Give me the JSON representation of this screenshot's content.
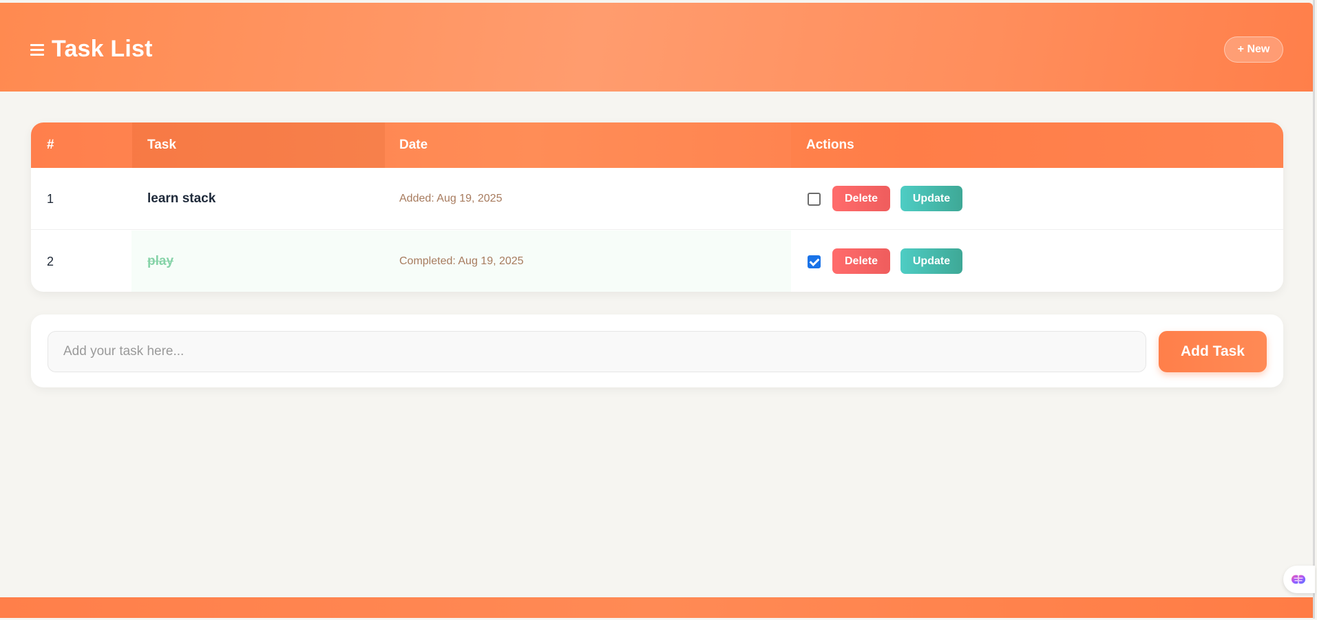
{
  "header": {
    "title": "Task List",
    "menu_icon": "hamburger-menu-icon",
    "new_button_label": "+ New"
  },
  "table": {
    "columns": [
      "#",
      "Task",
      "Date",
      "Actions"
    ],
    "rows": [
      {
        "num": "1",
        "task": "learn stack",
        "date": "Added: Aug 19, 2025",
        "completed": false,
        "delete_label": "Delete",
        "update_label": "Update"
      },
      {
        "num": "2",
        "task": "play",
        "date": "Completed: Aug 19, 2025",
        "completed": true,
        "delete_label": "Delete",
        "update_label": "Update"
      }
    ]
  },
  "form": {
    "input_placeholder": "Add your task here...",
    "input_value": "",
    "add_button_label": "Add Task"
  },
  "assistant": {
    "icon": "brain-icon"
  },
  "colors": {
    "accent": "#ff7f4a",
    "delete": "#ff6b6b",
    "update": "#4ecdc4",
    "completed_text": "#86d3a8",
    "date_text": "#a77b5e",
    "background": "#f6f5f1"
  }
}
